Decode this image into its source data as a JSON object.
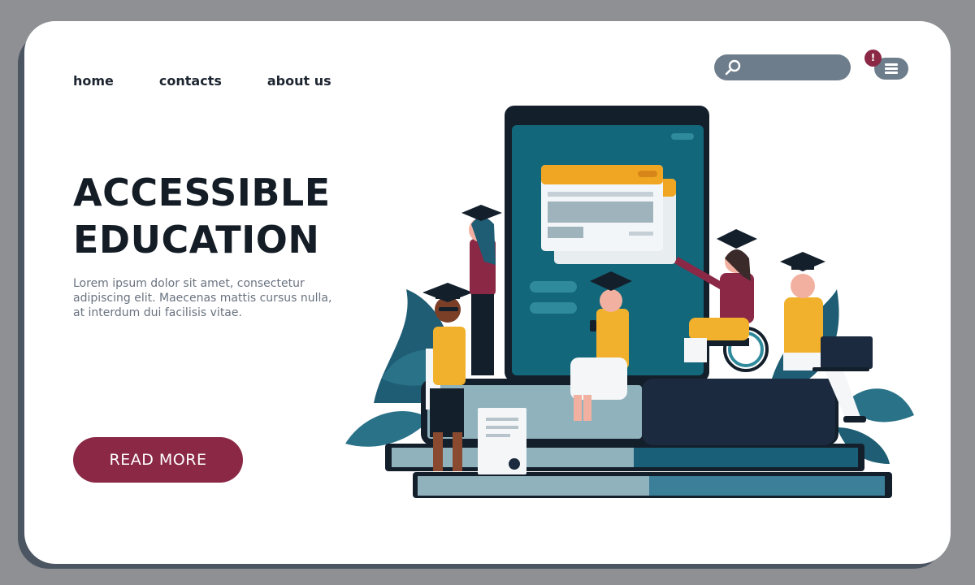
{
  "nav": {
    "items": [
      {
        "label": "home"
      },
      {
        "label": "contacts"
      },
      {
        "label": "about us"
      }
    ]
  },
  "search": {
    "placeholder": "",
    "value": "",
    "icon": "search-icon"
  },
  "menu": {
    "icon": "hamburger-menu-icon",
    "notification_badge": "!"
  },
  "hero": {
    "title_line1": "ACCESSIBLE",
    "title_line2": "EDUCATION",
    "body": "Lorem ipsum dolor sit amet, consectetur adipiscing elit. Maecenas mattis cursus nulla, at interdum dui facilisis vitae.",
    "cta_label": "READ MORE"
  },
  "colors": {
    "accent": "#8a2846",
    "nav_text": "#1d2530",
    "search_bg": "#6e7d8c",
    "tablet_screen": "#13677a",
    "orange": "#f0a623",
    "yellow": "#f2b12c"
  }
}
